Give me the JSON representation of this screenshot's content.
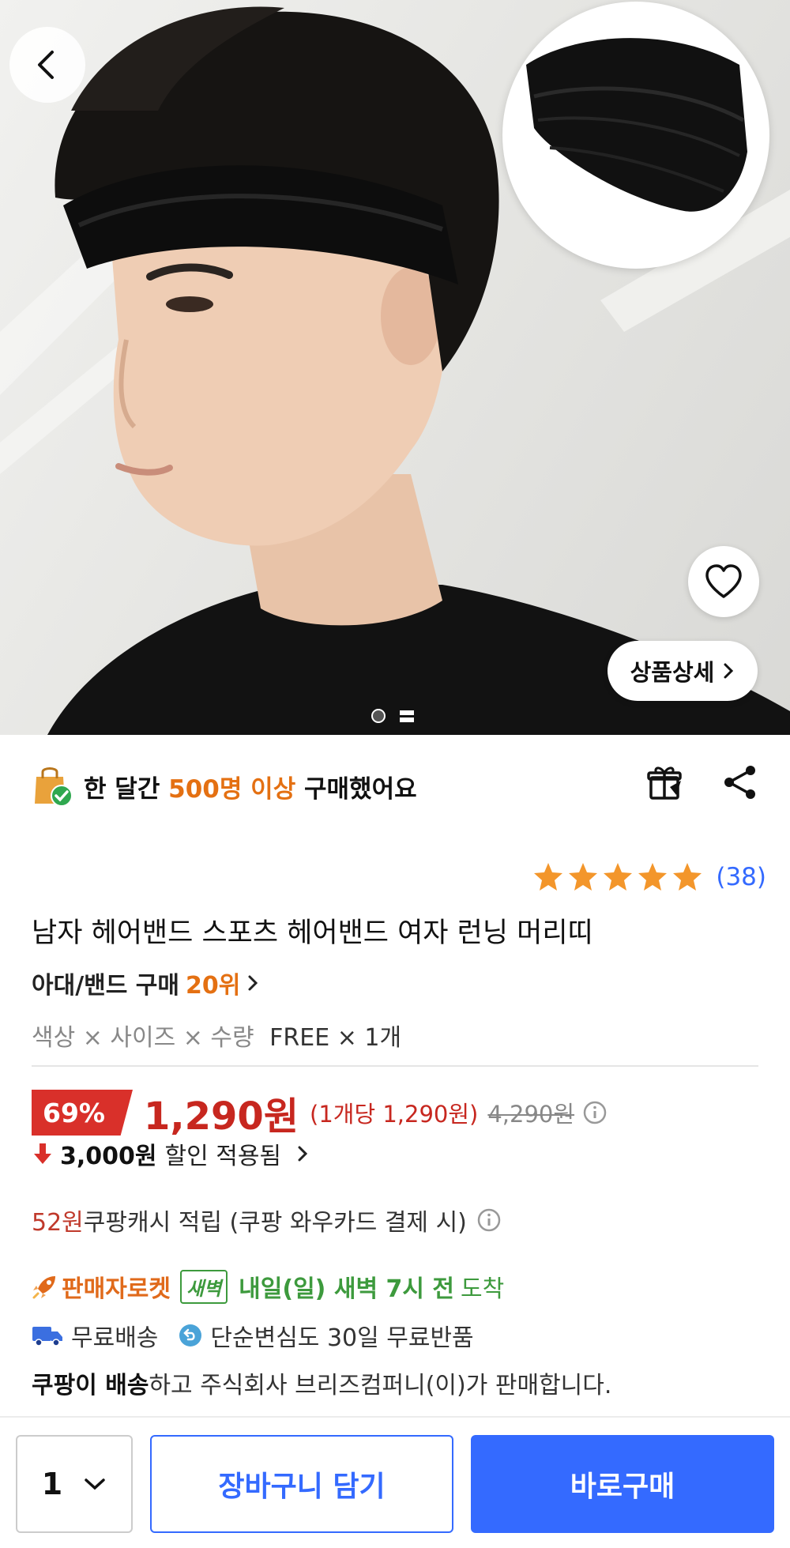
{
  "hero": {
    "image_alt": "man wearing black headband",
    "inset_alt": "black headband product",
    "detail_button_label": "상품상세",
    "page_indicator": {
      "current": 1,
      "total": 2
    }
  },
  "purchase_banner": {
    "prefix": "한 달간 ",
    "highlight": "500명 이상",
    "suffix": " 구매했어요"
  },
  "rating": {
    "stars": 5,
    "count_label": "(38)"
  },
  "product": {
    "title": "남자 헤어밴드 스포츠 헤어밴드 여자 런닝 머리띠",
    "rank_category": "아대/밴드 구매",
    "rank_number": "20위",
    "options_label": "색상 × 사이즈 × 수량",
    "options_value": "FREE × 1개"
  },
  "pricing": {
    "discount_rate": "69%",
    "sale_price": "1,290원",
    "unit_price": "(1개당 1,290원)",
    "original_price": "4,290원",
    "discount_amount": "3,000원",
    "discount_label": "할인 적용됨",
    "cash_amount": "52원",
    "cash_label": " 쿠팡캐시 적립 (쿠팡 와우카드 결제 시)"
  },
  "delivery": {
    "seller_rocket": "판매자로켓",
    "dawn_badge": "새벽",
    "arrival_time": "내일(일) 새벽 7시 전",
    "arrival_suffix": "도착",
    "free_shipping": "무료배송",
    "free_return": "단순변심도 30일 무료반품",
    "seller_bold": "쿠팡이 배송",
    "seller_rest": "하고 주식회사 브리즈컴퍼니(이)가 판매합니다."
  },
  "bottom_bar": {
    "quantity": "1",
    "cart_label": "장바구니 담기",
    "buy_label": "바로구매"
  },
  "colors": {
    "accent_blue": "#346aff",
    "price_red": "#c7271f",
    "highlight_orange": "#e47012",
    "dawn_green": "#3d9a3d"
  },
  "icons": [
    "back-arrow-icon",
    "heart-icon",
    "chevron-right-icon",
    "shopping-bag-check-icon",
    "gift-icon",
    "share-icon",
    "star-icon",
    "info-icon",
    "down-arrow-icon",
    "rocket-icon",
    "truck-icon",
    "return-icon",
    "chevron-down-icon"
  ]
}
